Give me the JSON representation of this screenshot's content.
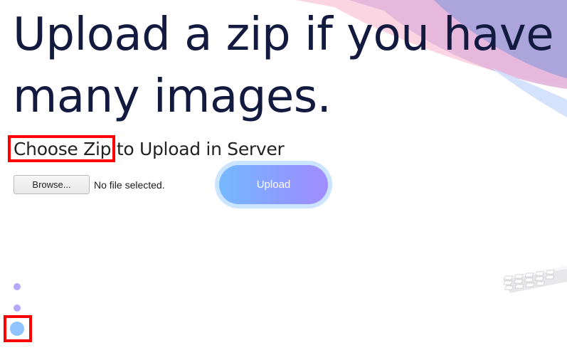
{
  "hero": {
    "title": "Upload a zip if you have many images."
  },
  "upload_form": {
    "heading_highlight": "Choose Zip",
    "heading_rest": " to Upload in Server",
    "browse_label": "Browse...",
    "file_status": "No file selected.",
    "upload_label": "Upload"
  },
  "carousel": {
    "dots": [
      "slide-1",
      "slide-2",
      "slide-3"
    ],
    "active_index": 2
  },
  "colors": {
    "title": "#131a40",
    "highlight": "#ff0000",
    "button_gradient_start": "#74b9ff",
    "button_gradient_end": "#a18cff",
    "dot_inactive": "#b4a8ff",
    "dot_active": "#8fc4ff"
  }
}
